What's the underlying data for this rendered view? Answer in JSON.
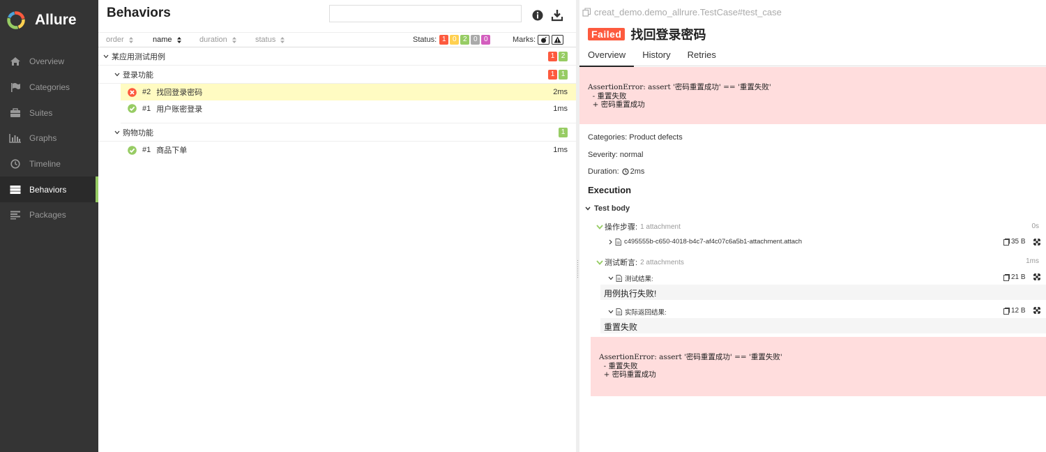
{
  "app": {
    "brand": "Allure"
  },
  "sidebar": {
    "items": [
      {
        "label": "Overview",
        "icon": "home-icon"
      },
      {
        "label": "Categories",
        "icon": "flag-icon"
      },
      {
        "label": "Suites",
        "icon": "briefcase-icon"
      },
      {
        "label": "Graphs",
        "icon": "bar-chart-icon"
      },
      {
        "label": "Timeline",
        "icon": "clock-icon"
      },
      {
        "label": "Behaviors",
        "icon": "list-icon",
        "active": true
      },
      {
        "label": "Packages",
        "icon": "align-left-icon"
      }
    ]
  },
  "behaviors": {
    "title": "Behaviors",
    "search_placeholder": "",
    "sort": {
      "order": "order",
      "name": "name",
      "duration": "duration",
      "status": "status"
    },
    "status_label": "Status:",
    "status_counts": {
      "failed": "1",
      "broken": "0",
      "passed": "2",
      "skipped": "0",
      "unknown": "0"
    },
    "marks_label": "Marks:",
    "tree": {
      "epic": {
        "name": "某应用测试用例",
        "failed": "1",
        "passed": "2"
      },
      "features": [
        {
          "name": "登录功能",
          "failed": "1",
          "passed": "1",
          "tests": [
            {
              "num": "#2",
              "name": "找回登录密码",
              "duration": "2ms",
              "status": "failed"
            },
            {
              "num": "#1",
              "name": "用户账密登录",
              "duration": "1ms",
              "status": "passed"
            }
          ]
        },
        {
          "name": "购物功能",
          "passed": "1",
          "tests": [
            {
              "num": "#1",
              "name": "商品下单",
              "duration": "1ms",
              "status": "passed"
            }
          ]
        }
      ]
    }
  },
  "testcase": {
    "path": "creat_demo.demo_allrure.TestCase#test_case",
    "status": "Failed",
    "title": "找回登录密码",
    "tabs": [
      "Overview",
      "History",
      "Retries"
    ],
    "error": "AssertionError: assert '密码重置成功' == '重置失败'\n  - 重置失败\n  + 密码重置成功",
    "categories": "Categories: Product defects",
    "severity": "Severity: normal",
    "duration_label": "Duration:",
    "duration": "2ms",
    "execution_title": "Execution",
    "test_body": "Test body",
    "steps": [
      {
        "name": "操作步骤:",
        "attach_count": "1 attachment",
        "duration": "0s",
        "attachments": [
          {
            "name": "c495555b-c650-4018-b4c7-af4c07c6a5b1-attachment.attach",
            "size": "35 B",
            "expanded": false
          }
        ]
      },
      {
        "name": "测试断言:",
        "attach_count": "2 attachments",
        "duration": "1ms",
        "attachments": [
          {
            "name": "测试结果:",
            "size": "21 B",
            "expanded": true,
            "content": "用例执行失败!"
          },
          {
            "name": "实际返回结果:",
            "size": "12 B",
            "expanded": true,
            "content": "重置失败"
          }
        ]
      }
    ],
    "error_bottom": "AssertionError: assert '密码重置成功' == '重置失败'\n  - 重置失败\n  + 密码重置成功"
  },
  "colors": {
    "failed": "#fd5a3e",
    "passed": "#97cc64",
    "broken": "#ffd050",
    "skipped": "#aaaaaa",
    "unknown": "#d35ebe",
    "sidebar": "#343434"
  }
}
